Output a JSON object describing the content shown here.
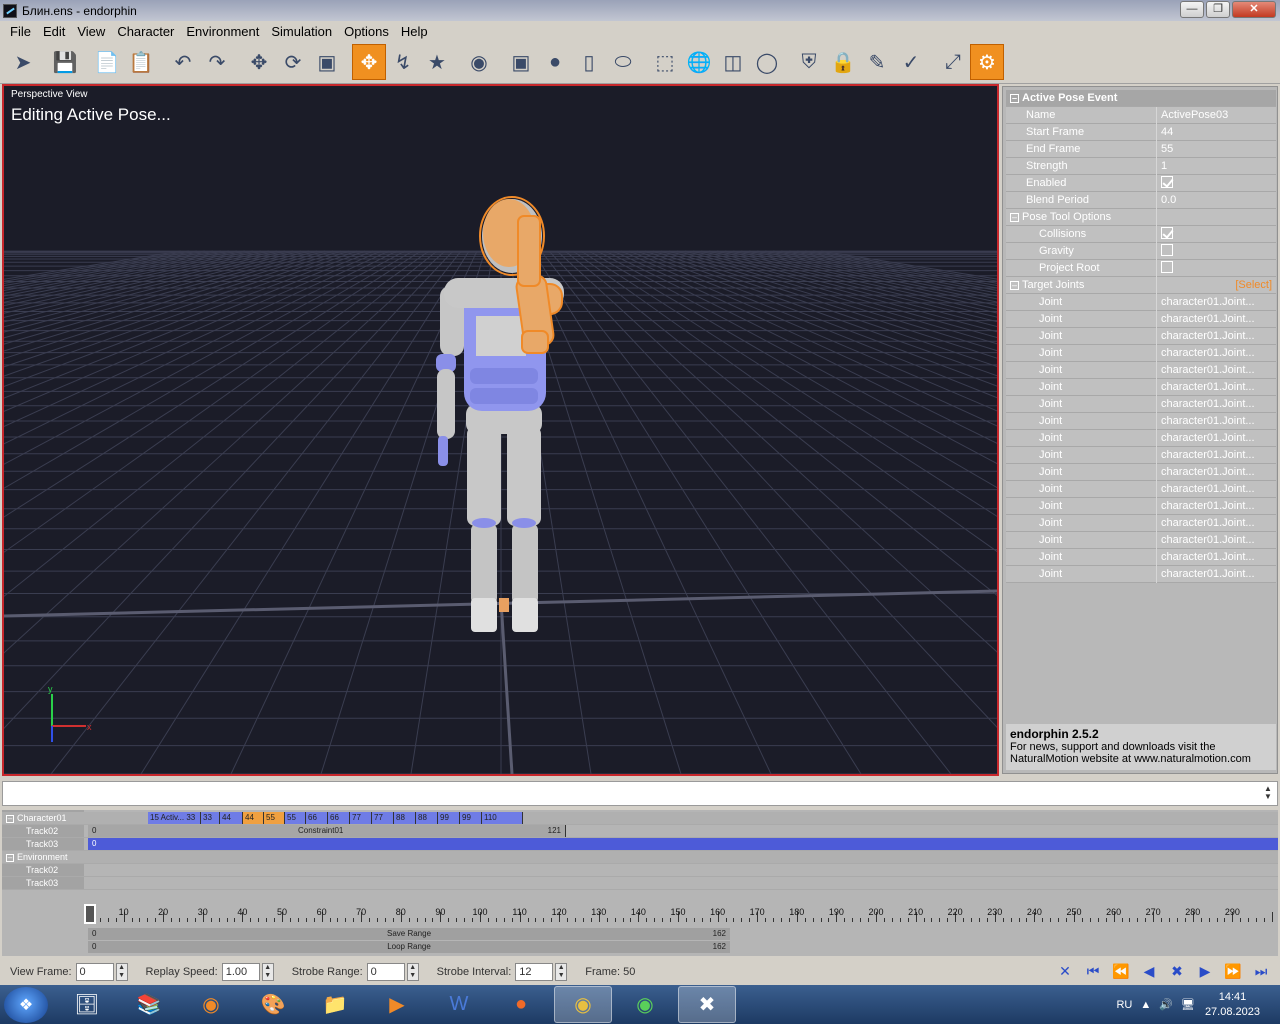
{
  "window": {
    "title": "Блин.ens - endorphin"
  },
  "menu": [
    "File",
    "Edit",
    "View",
    "Character",
    "Environment",
    "Simulation",
    "Options",
    "Help"
  ],
  "viewport": {
    "label": "Perspective View",
    "status": "Editing Active Pose...",
    "axis_x": "x",
    "axis_y": "y"
  },
  "properties": {
    "section_title": "Active Pose Event",
    "name": {
      "label": "Name",
      "value": "ActivePose03"
    },
    "start_frame": {
      "label": "Start Frame",
      "value": "44"
    },
    "end_frame": {
      "label": "End Frame",
      "value": "55"
    },
    "strength": {
      "label": "Strength",
      "value": "1"
    },
    "enabled": {
      "label": "Enabled",
      "checked": true
    },
    "blend_period": {
      "label": "Blend Period",
      "value": "0.0"
    },
    "pose_tool_options": {
      "title": "Pose Tool Options",
      "collisions": {
        "label": "Collisions",
        "checked": true
      },
      "gravity": {
        "label": "Gravity",
        "checked": false
      },
      "project_root": {
        "label": "Project Root",
        "checked": false
      }
    },
    "target_joints": {
      "title": "Target Joints",
      "select_label": "[Select]",
      "joints": [
        {
          "label": "Joint",
          "value": "character01.Joint..."
        },
        {
          "label": "Joint",
          "value": "character01.Joint..."
        },
        {
          "label": "Joint",
          "value": "character01.Joint..."
        },
        {
          "label": "Joint",
          "value": "character01.Joint..."
        },
        {
          "label": "Joint",
          "value": "character01.Joint..."
        },
        {
          "label": "Joint",
          "value": "character01.Joint..."
        },
        {
          "label": "Joint",
          "value": "character01.Joint..."
        },
        {
          "label": "Joint",
          "value": "character01.Joint..."
        },
        {
          "label": "Joint",
          "value": "character01.Joint..."
        },
        {
          "label": "Joint",
          "value": "character01.Joint..."
        },
        {
          "label": "Joint",
          "value": "character01.Joint..."
        },
        {
          "label": "Joint",
          "value": "character01.Joint..."
        },
        {
          "label": "Joint",
          "value": "character01.Joint..."
        },
        {
          "label": "Joint",
          "value": "character01.Joint..."
        },
        {
          "label": "Joint",
          "value": "character01.Joint..."
        },
        {
          "label": "Joint",
          "value": "character01.Joint..."
        },
        {
          "label": "Joint",
          "value": "character01.Joint..."
        }
      ]
    }
  },
  "info": {
    "title": "endorphin 2.5.2",
    "text": "For news, support and downloads visit the NaturalMotion website at www.naturalmotion.com"
  },
  "timeline": {
    "groups": {
      "character": "Character01",
      "environment": "Environment"
    },
    "tracks": {
      "char_track02": "Track02",
      "char_track03": "Track03",
      "env_track02": "Track02",
      "env_track03": "Track03"
    },
    "segments": [
      "15  Activ...  33",
      "33",
      "44",
      "44",
      "55",
      "55",
      "66",
      "66",
      "77",
      "77",
      "88",
      "88",
      "99",
      "99",
      "110"
    ],
    "constraint": {
      "start": "0",
      "label": "Constraint01",
      "end": "121"
    },
    "track03_start": "0",
    "ruler_labels": [
      "10",
      "20",
      "30",
      "40",
      "50",
      "60",
      "70",
      "80",
      "90",
      "100",
      "110",
      "120",
      "130",
      "140",
      "150",
      "160",
      "170",
      "180",
      "190",
      "200",
      "210",
      "220",
      "230",
      "240",
      "250",
      "260",
      "270",
      "280",
      "290"
    ],
    "save_range": {
      "start": "0",
      "label": "Save Range",
      "end": "162"
    },
    "loop_range": {
      "start": "0",
      "label": "Loop Range",
      "end": "162"
    }
  },
  "statusbar": {
    "view_frame": {
      "label": "View Frame:",
      "value": "0"
    },
    "replay_speed": {
      "label": "Replay Speed:",
      "value": "1.00"
    },
    "strobe_range": {
      "label": "Strobe Range:",
      "value": "0"
    },
    "strobe_interval": {
      "label": "Strobe Interval:",
      "value": "12"
    },
    "frame": "Frame: 50"
  },
  "taskbar": {
    "language": "RU",
    "time": "14:41",
    "date": "27.08.2023"
  }
}
